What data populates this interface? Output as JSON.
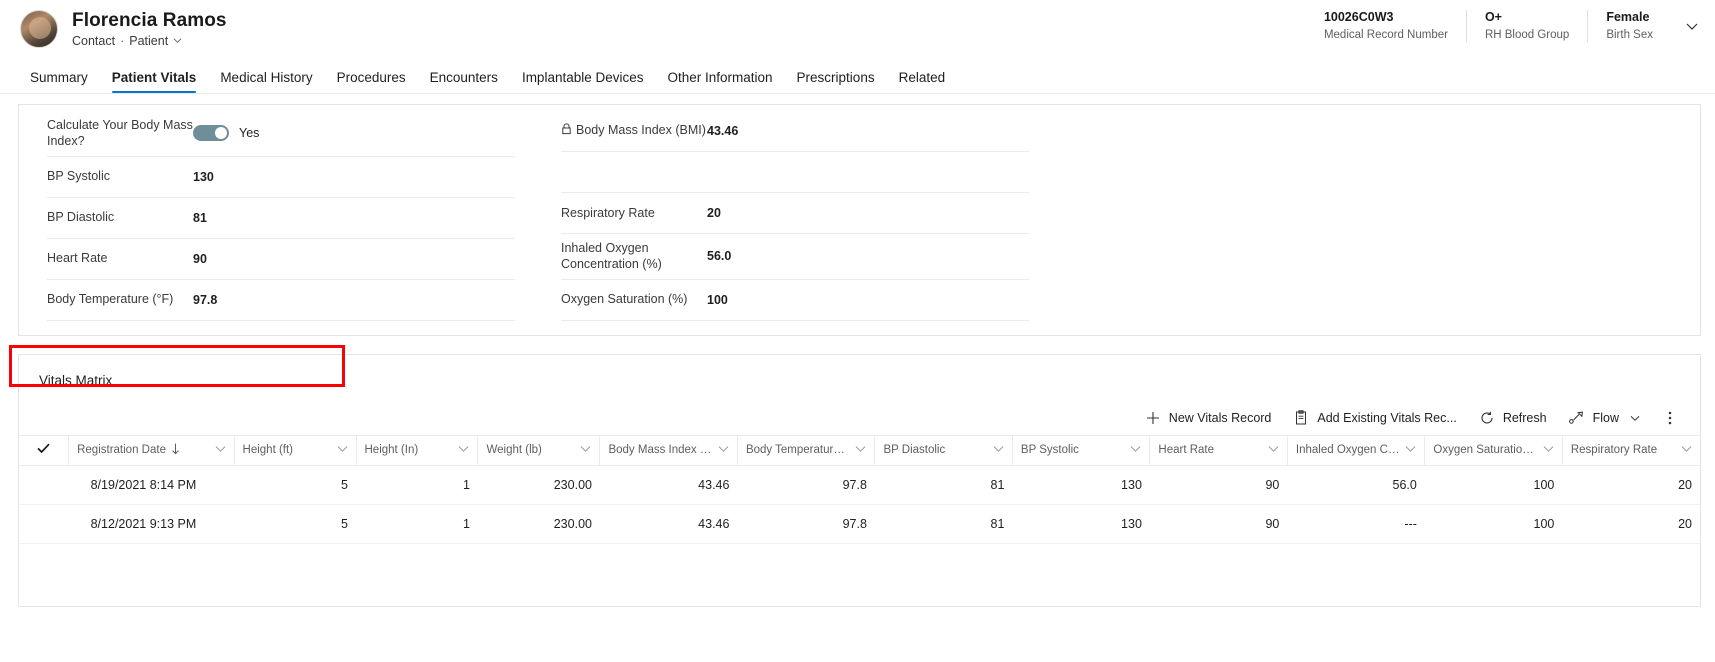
{
  "header": {
    "patient_name": "Florencia Ramos",
    "entity_type": "Contact",
    "separator": "·",
    "role": "Patient",
    "facts": [
      {
        "value": "10026C0W3",
        "label": "Medical Record Number"
      },
      {
        "value": "O+",
        "label": "RH Blood Group"
      },
      {
        "value": "Female",
        "label": "Birth Sex"
      }
    ],
    "expand_icon": "chevron-down-icon"
  },
  "tabs": [
    {
      "label": "Summary",
      "active": false
    },
    {
      "label": "Patient Vitals",
      "active": true
    },
    {
      "label": "Medical History",
      "active": false
    },
    {
      "label": "Procedures",
      "active": false
    },
    {
      "label": "Encounters",
      "active": false
    },
    {
      "label": "Implantable Devices",
      "active": false
    },
    {
      "label": "Other Information",
      "active": false
    },
    {
      "label": "Prescriptions",
      "active": false
    },
    {
      "label": "Related",
      "active": false
    }
  ],
  "form": {
    "left": [
      {
        "label": "Calculate Your Body Mass Index?",
        "value": "Yes",
        "type": "toggle",
        "toggle_on": true
      },
      {
        "label": "BP Systolic",
        "value": "130",
        "type": "text"
      },
      {
        "label": "BP Diastolic",
        "value": "81",
        "type": "text"
      },
      {
        "label": "Heart Rate",
        "value": "90",
        "type": "text"
      },
      {
        "label": "Body Temperature (°F)",
        "value": "97.8",
        "type": "text"
      }
    ],
    "right": [
      {
        "label": "Body Mass Index (BMI)",
        "value": "43.46",
        "type": "text",
        "locked": true
      },
      {
        "label": "",
        "value": "",
        "type": "blank"
      },
      {
        "label": "Respiratory Rate",
        "value": "20",
        "type": "text"
      },
      {
        "label": "Inhaled Oxygen Concentration (%)",
        "value": "56.0",
        "type": "text"
      },
      {
        "label": "Oxygen Saturation (%)",
        "value": "100",
        "type": "text"
      }
    ]
  },
  "grid": {
    "title": "Vitals Matrix",
    "commands": [
      {
        "label": "New Vitals Record",
        "icon": "plus-icon"
      },
      {
        "label": "Add Existing Vitals Rec...",
        "icon": "add-existing-icon"
      },
      {
        "label": "Refresh",
        "icon": "refresh-icon"
      },
      {
        "label": "Flow",
        "icon": "flow-icon",
        "has_chevron": true
      },
      {
        "label": "",
        "icon": "kebab-icon"
      }
    ],
    "select_all_icon": "checkmark-icon",
    "columns": [
      {
        "label": "Registration Date",
        "sorted": true,
        "sort_dir": "desc"
      },
      {
        "label": "Height (ft)",
        "sorted": false
      },
      {
        "label": "Height (In)",
        "sorted": false
      },
      {
        "label": "Weight (lb)",
        "sorted": false
      },
      {
        "label": "Body Mass Index (B...",
        "sorted": false
      },
      {
        "label": "Body Temperature (...",
        "sorted": false
      },
      {
        "label": "BP Diastolic",
        "sorted": false
      },
      {
        "label": "BP Systolic",
        "sorted": false
      },
      {
        "label": "Heart Rate",
        "sorted": false
      },
      {
        "label": "Inhaled Oxygen Con...",
        "sorted": false
      },
      {
        "label": "Oxygen Saturation (...",
        "sorted": false
      },
      {
        "label": "Respiratory Rate",
        "sorted": false
      }
    ],
    "rows": [
      {
        "cells": [
          "8/19/2021 8:14 PM",
          "5",
          "1",
          "230.00",
          "43.46",
          "97.8",
          "81",
          "130",
          "90",
          "56.0",
          "100",
          "20"
        ]
      },
      {
        "cells": [
          "8/12/2021 9:13 PM",
          "5",
          "1",
          "230.00",
          "43.46",
          "97.8",
          "81",
          "130",
          "90",
          "---",
          "100",
          "20"
        ]
      }
    ]
  },
  "colors": {
    "accent": "#0078d4",
    "highlight_box": "#fb0007",
    "toggle_on": "#6f8e99",
    "text_primary": "#201f1e",
    "text_secondary": "#605e5c",
    "border": "#edebe9"
  }
}
